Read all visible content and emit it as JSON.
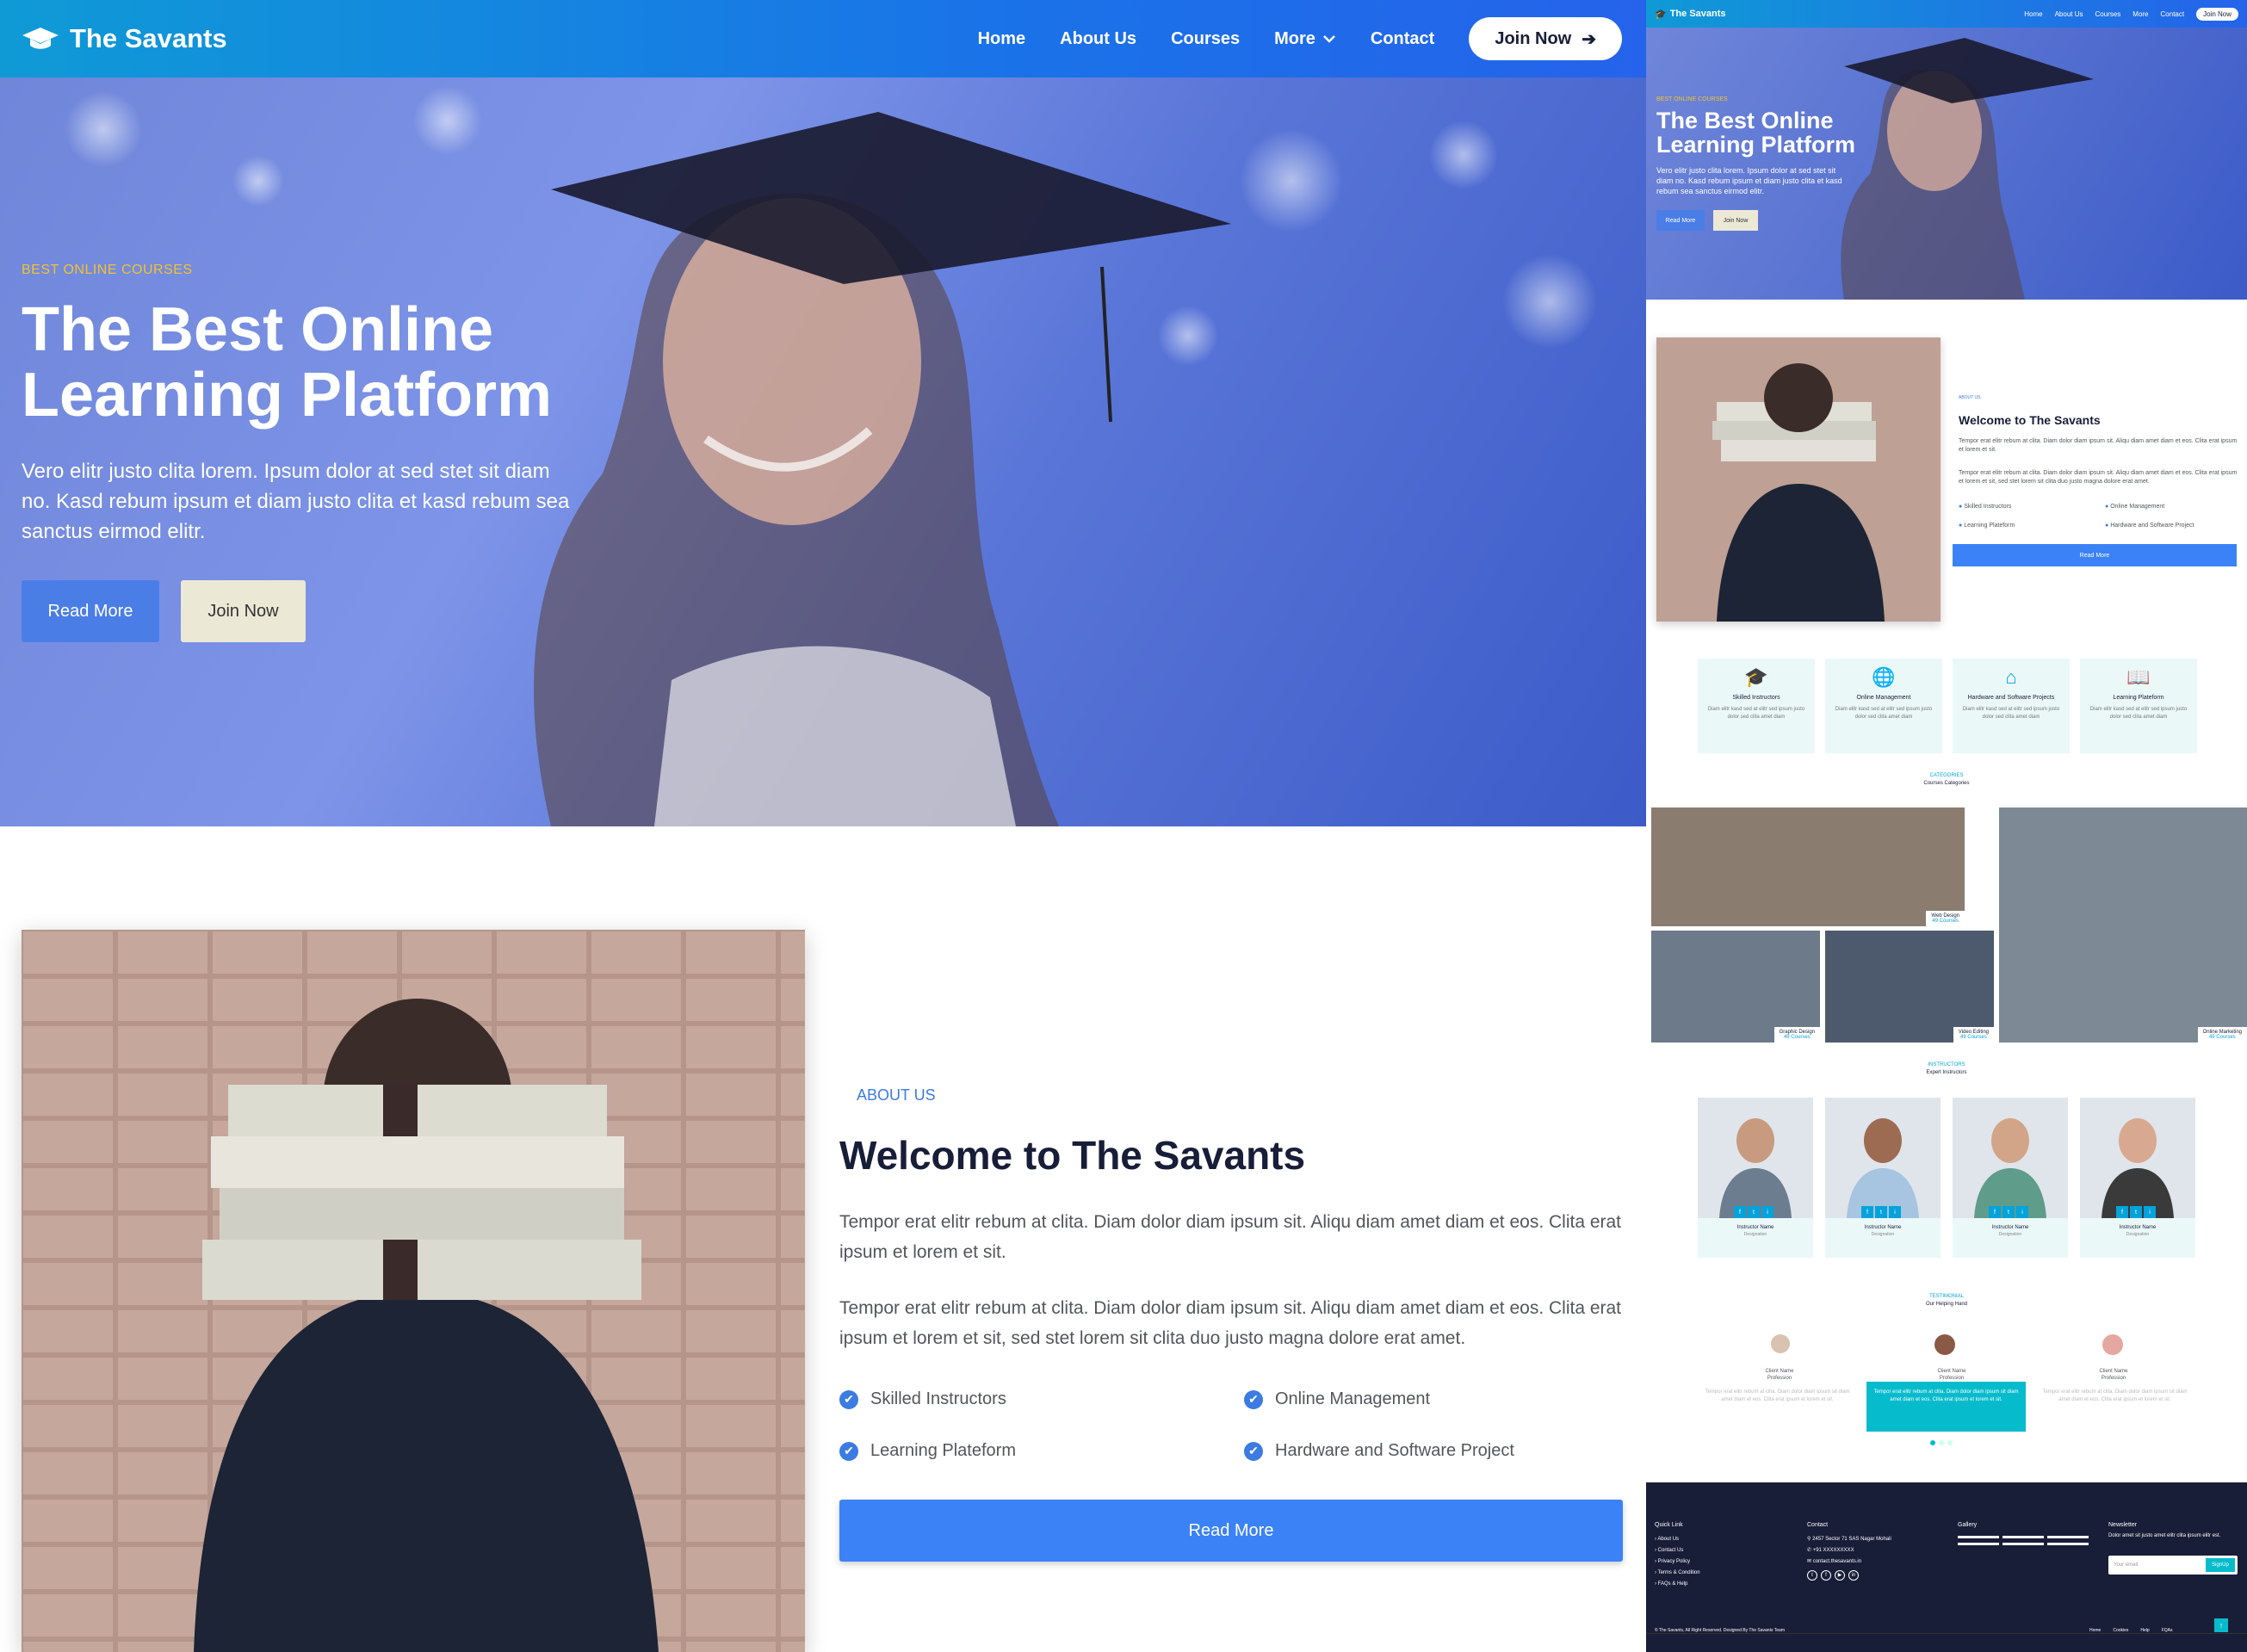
{
  "nav": {
    "brand": "The Savants",
    "items": [
      "Home",
      "About Us",
      "Courses",
      "More",
      "Contact"
    ],
    "join": "Join Now"
  },
  "hero": {
    "tag": "BEST ONLINE COURSES",
    "title": "The Best Online Learning Platform",
    "subtitle": "Vero elitr justo clita lorem. Ipsum dolor at sed stet sit diam no. Kasd rebum ipsum et diam justo clita et kasd rebum sea sanctus eirmod elitr.",
    "read_more": "Read More",
    "join_now": "Join Now"
  },
  "about": {
    "tag": "ABOUT US",
    "title": "Welcome to The Savants",
    "p1": "Tempor erat elitr rebum at clita. Diam dolor diam ipsum sit. Aliqu diam amet diam et eos. Clita erat ipsum et lorem et sit.",
    "p2": "Tempor erat elitr rebum at clita. Diam dolor diam ipsum sit. Aliqu diam amet diam et eos. Clita erat ipsum et lorem et sit, sed stet lorem sit clita duo justo magna dolore erat amet.",
    "features": [
      "Skilled Instructors",
      "Online Management",
      "Learning Plateform",
      "Hardware and Software Project"
    ],
    "button": "Read More"
  },
  "mini": {
    "services": [
      {
        "icon": "graduation-cap-icon",
        "title": "Skilled Instructors",
        "desc": "Diam elitr kasd sed at elitr sed ipsum justo dolor sed clita amet diam"
      },
      {
        "icon": "globe-icon",
        "title": "Online Management",
        "desc": "Diam elitr kasd sed at elitr sed ipsum justo dolor sed clita amet diam"
      },
      {
        "icon": "home-icon",
        "title": "Hardware and Software Projects",
        "desc": "Diam elitr kasd sed at elitr sed ipsum justo dolor sed clita amet diam"
      },
      {
        "icon": "book-icon",
        "title": "Learning Plateform",
        "desc": "Diam elitr kasd sed at elitr sed ipsum justo dolor sed clita amet diam"
      }
    ],
    "categories": {
      "tag": "CATEGORIES",
      "title": "Courses Categories",
      "items": [
        {
          "name": "Web Design",
          "count": "49 Courses"
        },
        {
          "name": "Graphic Design",
          "count": "49 Courses"
        },
        {
          "name": "Video Editing",
          "count": "49 Courses"
        },
        {
          "name": "Online Marketing",
          "count": "49 Courses"
        }
      ]
    },
    "instructors": {
      "tag": "INSTRUCTORS",
      "title": "Expert Instructors",
      "name": "Instructor Name",
      "designation": "Designation"
    },
    "testimonial": {
      "tag": "TESTIMONIAL",
      "title": "Our Helping Hand",
      "client": "Client Name",
      "profession": "Profession",
      "text": "Tempor erat elitr rebum at clita. Diam dolor diam ipsum sit diam amet diam et eos. Clita erat ipsum et lorem et sit."
    },
    "footer": {
      "quick_title": "Quick Link",
      "quick": [
        "About Us",
        "Contact Us",
        "Privacy Policy",
        "Terms & Condition",
        "FAQs & Help"
      ],
      "contact_title": "Contact",
      "address": "2457 Sector 71 SAS Nagar Mohali",
      "phone": "+91 XXXXXXXXX",
      "email": "contact.thesavants.in",
      "gallery_title": "Gallery",
      "news_title": "Newsletter",
      "news_text": "Dolor amet sit justo amet elitr clita ipsum elitr est.",
      "news_placeholder": "Your email",
      "signup": "SignUp",
      "copyright": "© The Savants, All Right Reserved. Designed By The Savants Team",
      "links": [
        "Home",
        "Cookies",
        "Help",
        "FQAs"
      ]
    }
  }
}
